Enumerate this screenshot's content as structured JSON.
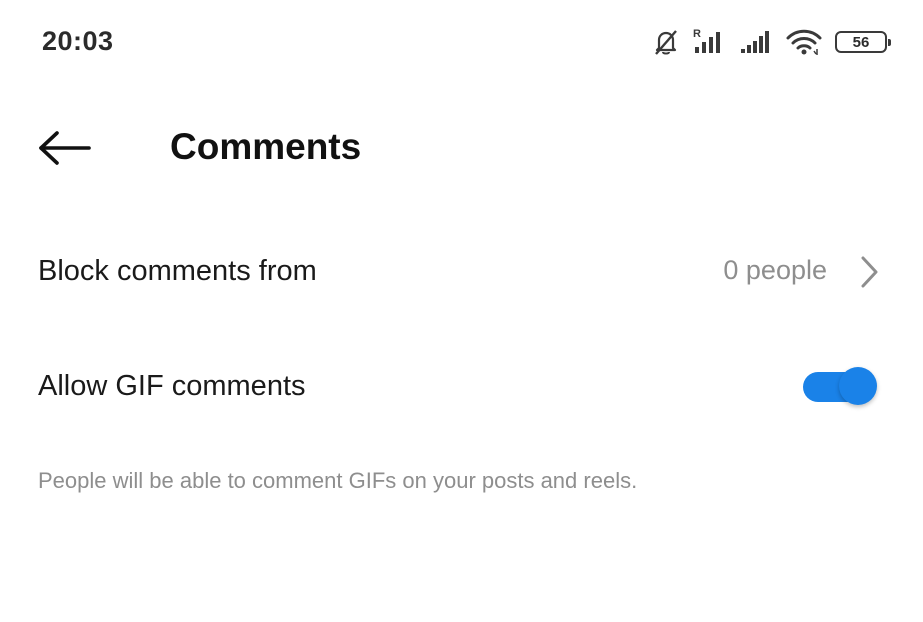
{
  "status_bar": {
    "time": "20:03",
    "battery_level": "56",
    "icons": [
      "bell-muted-icon",
      "signal-roaming-icon",
      "signal-icon",
      "wifi-icon",
      "battery-icon"
    ]
  },
  "header": {
    "back_icon": "arrow-left-icon",
    "title": "Comments"
  },
  "settings": {
    "block_comments": {
      "label": "Block comments from",
      "value": "0 people",
      "icon": "chevron-right-icon"
    },
    "allow_gif": {
      "label": "Allow GIF comments",
      "enabled": true,
      "helper": "People will be able to comment GIFs on your posts and reels."
    }
  },
  "colors": {
    "accent": "#1a82e8",
    "accent_track": "#1a82e8",
    "secondary_text": "#8e8e8e"
  }
}
